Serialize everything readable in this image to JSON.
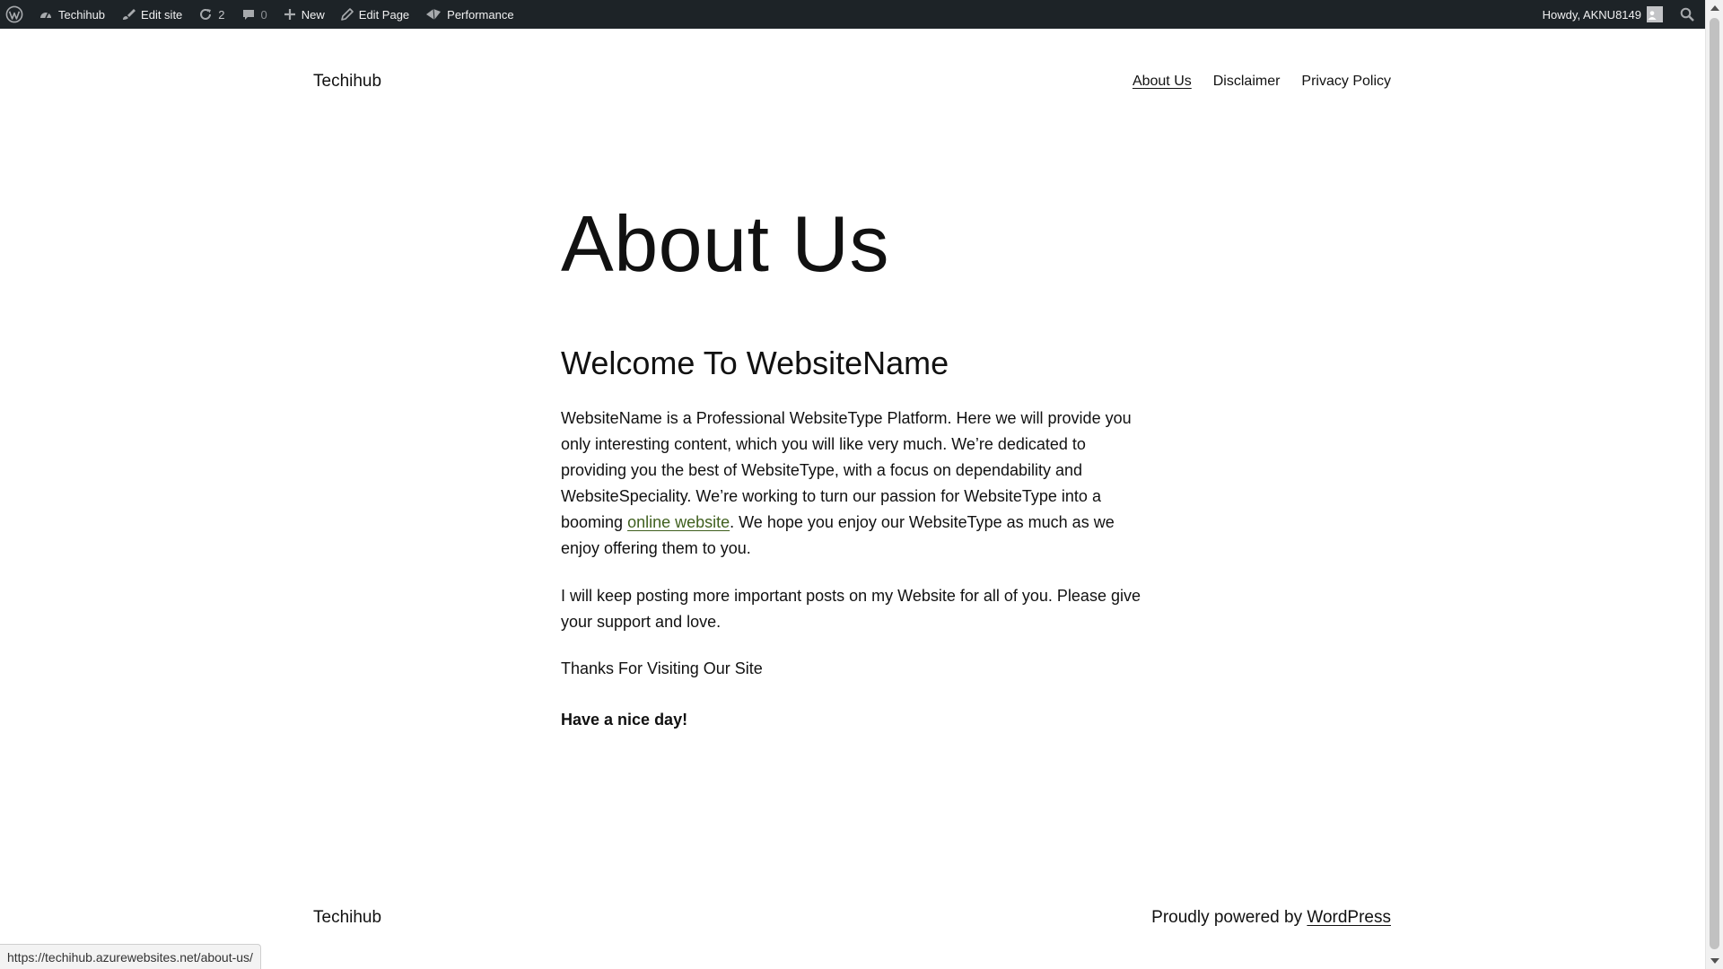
{
  "adminbar": {
    "site_name": "Techihub",
    "edit_site": "Edit site",
    "updates_count": "2",
    "comments_count": "0",
    "new_label": "New",
    "edit_page": "Edit Page",
    "performance": "Performance",
    "howdy": "Howdy, AKNU8149",
    "icons": [
      "wordpress-logo-icon",
      "dashboard-icon",
      "brush-icon",
      "updates-icon",
      "comment-icon",
      "plus-icon",
      "pencil-icon",
      "performance-icon",
      "avatar-icon",
      "search-icon"
    ]
  },
  "header": {
    "site_title": "Techihub",
    "nav": [
      "About Us",
      "Disclaimer",
      "Privacy Policy"
    ]
  },
  "main": {
    "title": "About Us",
    "subtitle": "Welcome To WebsiteName",
    "p1_before": "WebsiteName is a Professional WebsiteType Platform. Here we will provide you only interesting content, which you will like very much. We’re dedicated to providing you the best of WebsiteType, with a focus on dependability and WebsiteSpeciality. We’re working to turn our passion for WebsiteType into a booming ",
    "p1_link": "online website",
    "p1_after": ". We hope you enjoy our WebsiteType as much as we enjoy offering them to you.",
    "p2": "I will keep posting more important posts on my Website for all of you. Please give your support and love.",
    "p3": "Thanks For Visiting Our Site",
    "p4": "Have a nice day!"
  },
  "footer": {
    "site_title": "Techihub",
    "credit_prefix": "Proudly powered by ",
    "credit_link": "WordPress"
  },
  "status_bar": {
    "url": "https://techihub.azurewebsites.net/about-us/"
  },
  "colors": {
    "adminbar_bg": "#1d2327",
    "adminbar_text": "#f0f0f1",
    "link_green": "#3f5f1e",
    "text": "#111111"
  }
}
